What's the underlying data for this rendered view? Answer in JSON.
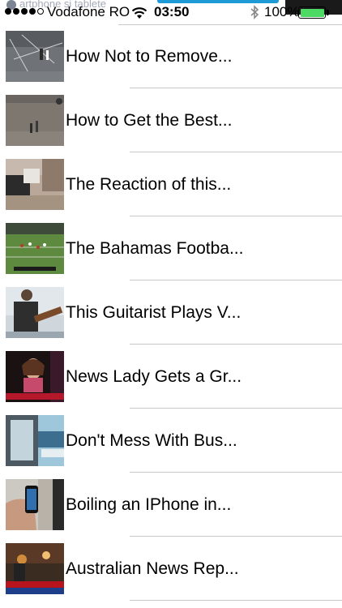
{
  "status_bar": {
    "watermark": "artphone si tablete",
    "carrier": "Vodafone RO",
    "time": "03:50",
    "battery_percent": "100%",
    "battery_color": "#4cd964",
    "signal_dots": 5,
    "signal_filled": 4,
    "icons": [
      "wifi-icon",
      "bluetooth-icon",
      "battery-icon"
    ]
  },
  "videos": [
    {
      "title": "How Not to Remove...",
      "thumbnail": "parking-lot-scene"
    },
    {
      "title": "How to Get the Best...",
      "thumbnail": "street-people-scene"
    },
    {
      "title": "The Reaction of this...",
      "thumbnail": "room-people-scene"
    },
    {
      "title": "The Bahamas Footba...",
      "thumbnail": "football-field-scene"
    },
    {
      "title": "This Guitarist Plays V...",
      "thumbnail": "guitarist-scene"
    },
    {
      "title": "News Lady Gets a Gr...",
      "thumbnail": "news-anchor-scene"
    },
    {
      "title": "Don't Mess With Bus...",
      "thumbnail": "bus-door-scene"
    },
    {
      "title": "Boiling an IPhone in...",
      "thumbnail": "iphone-hand-scene"
    },
    {
      "title": "Australian News Rep...",
      "thumbnail": "news-report-scene"
    }
  ]
}
